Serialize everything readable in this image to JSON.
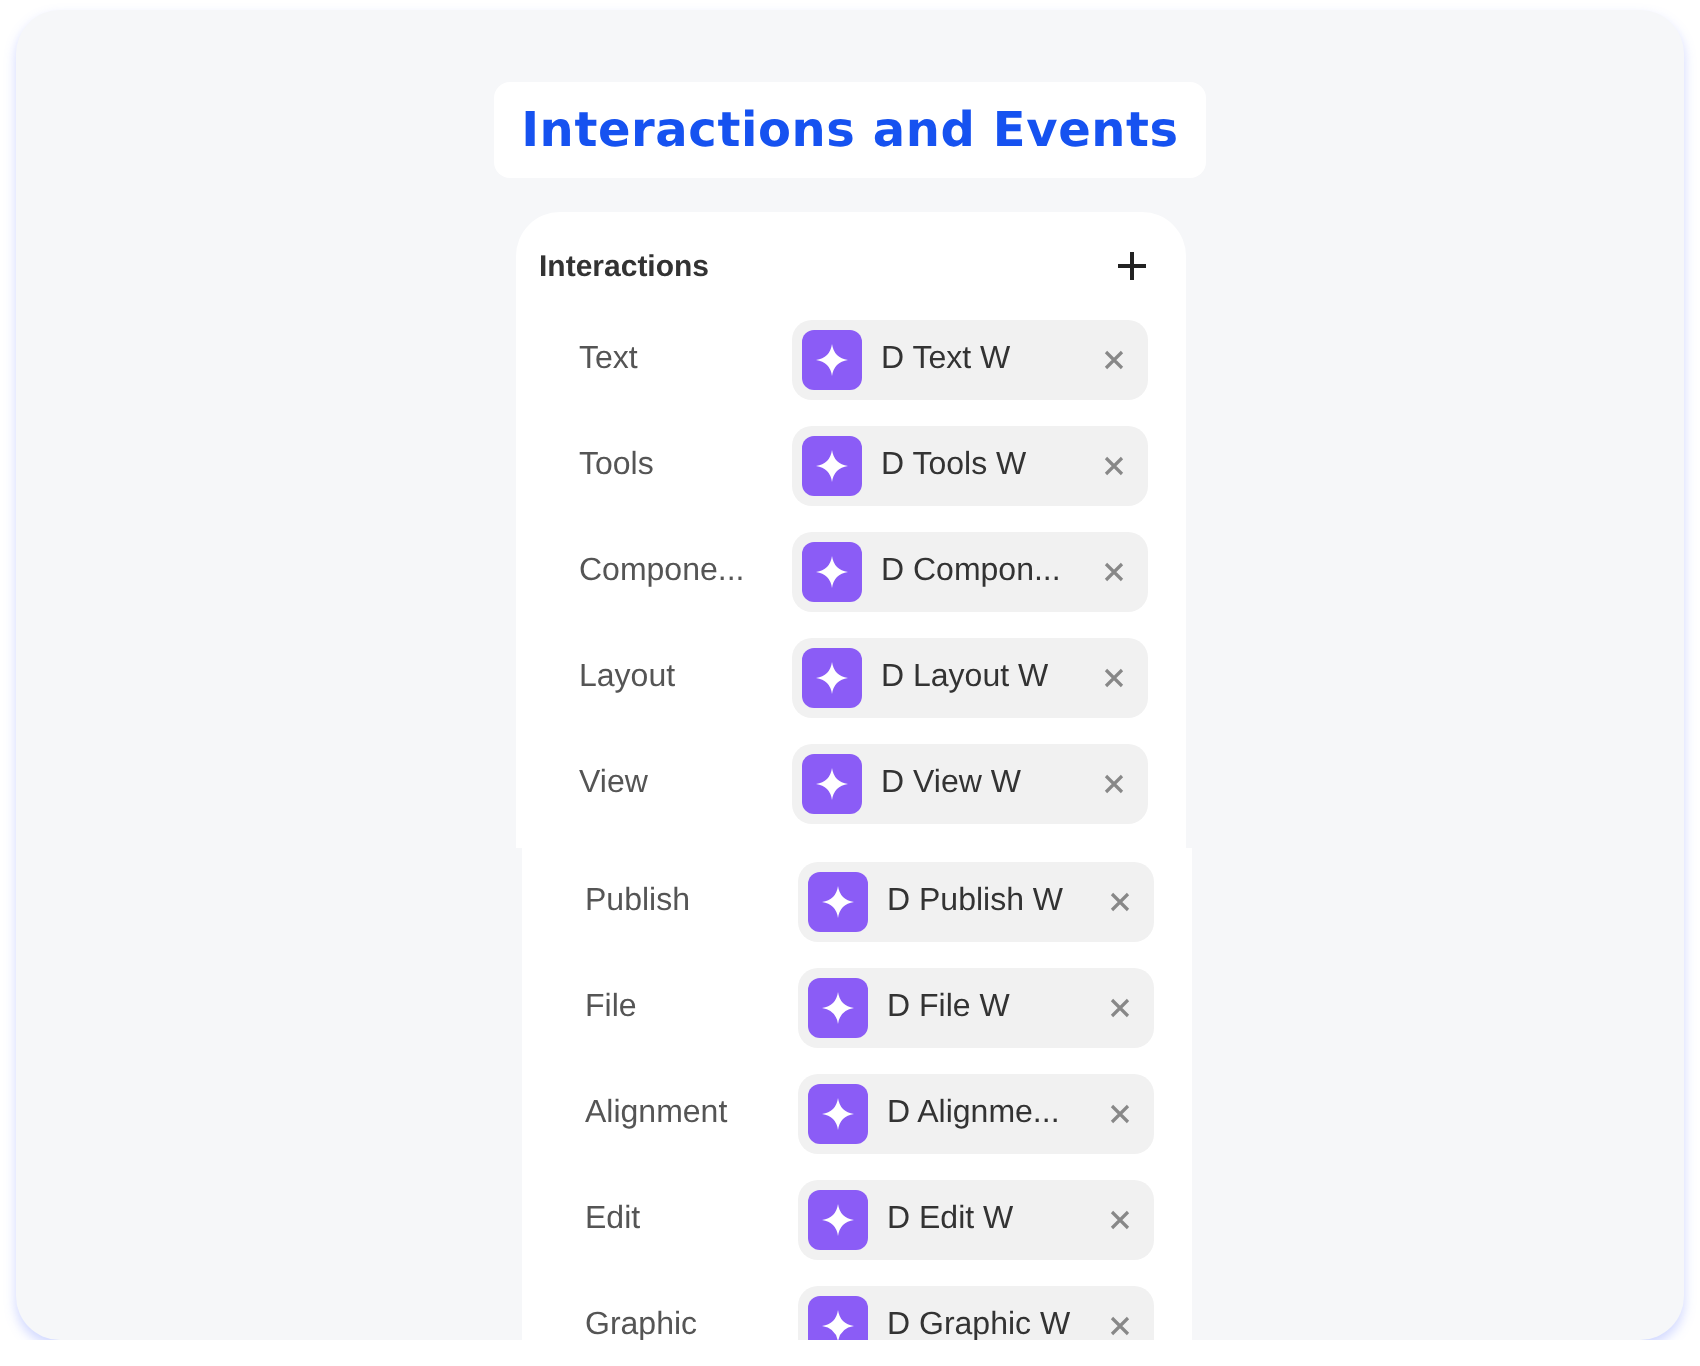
{
  "title": "Interactions and Events",
  "panels": [
    {
      "heading": "Interactions",
      "rows": [
        {
          "label": "Text",
          "value": "D Text W"
        },
        {
          "label": "Tools",
          "value": "D Tools W"
        },
        {
          "label": "Compone...",
          "value": "D Compon..."
        },
        {
          "label": "Layout",
          "value": "D Layout W"
        },
        {
          "label": "View",
          "value": "D View W"
        }
      ]
    },
    {
      "rows": [
        {
          "label": "Publish",
          "value": "D Publish W"
        },
        {
          "label": "File",
          "value": "D File W"
        },
        {
          "label": "Alignment",
          "value": "D Alignme..."
        },
        {
          "label": "Edit",
          "value": "D Edit W"
        },
        {
          "label": "Graphic",
          "value": "D Graphic W"
        }
      ]
    }
  ]
}
